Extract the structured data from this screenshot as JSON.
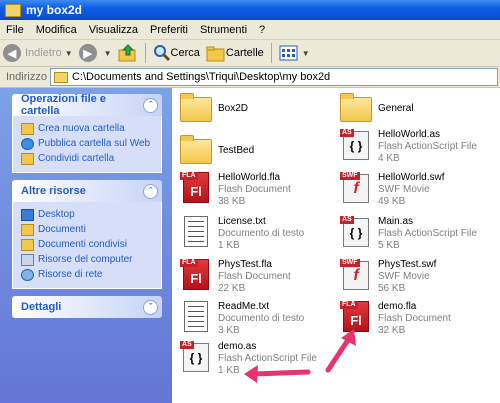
{
  "window": {
    "title": "my box2d"
  },
  "menu": [
    "File",
    "Modifica",
    "Visualizza",
    "Preferiti",
    "Strumenti",
    "?"
  ],
  "toolbar": {
    "back_label": "Indietro",
    "search_label": "Cerca",
    "folders_label": "Cartelle"
  },
  "address": {
    "label": "Indirizzo",
    "path": "C:\\Documents and Settings\\Triqui\\Desktop\\my box2d"
  },
  "left_panels": {
    "tasks": {
      "title": "Operazioni file e cartella",
      "items": [
        "Crea nuova cartella",
        "Pubblica cartella sul Web",
        "Condividi cartella"
      ]
    },
    "places": {
      "title": "Altre risorse",
      "items": [
        "Desktop",
        "Documenti",
        "Documenti condivisi",
        "Risorse del computer",
        "Risorse di rete"
      ]
    },
    "details": {
      "title": "Dettagli"
    }
  },
  "files": [
    {
      "name": "Box2D",
      "type": "",
      "size": "",
      "icon": "folder-icon"
    },
    {
      "name": "General",
      "type": "",
      "size": "",
      "icon": "folder-icon"
    },
    {
      "name": "TestBed",
      "type": "",
      "size": "",
      "icon": "folder-icon"
    },
    {
      "name": "HelloWorld.as",
      "type": "Flash ActionScript File",
      "size": "4 KB",
      "icon": "actionscript-file-icon"
    },
    {
      "name": "HelloWorld.fla",
      "type": "Flash Document",
      "size": "38 KB",
      "icon": "flash-document-icon"
    },
    {
      "name": "HelloWorld.swf",
      "type": "SWF Movie",
      "size": "49 KB",
      "icon": "swf-movie-icon"
    },
    {
      "name": "License.txt",
      "type": "Documento di testo",
      "size": "1 KB",
      "icon": "text-document-icon"
    },
    {
      "name": "Main.as",
      "type": "Flash ActionScript File",
      "size": "5 KB",
      "icon": "actionscript-file-icon"
    },
    {
      "name": "PhysTest.fla",
      "type": "Flash Document",
      "size": "22 KB",
      "icon": "flash-document-icon"
    },
    {
      "name": "PhysTest.swf",
      "type": "SWF Movie",
      "size": "56 KB",
      "icon": "swf-movie-icon"
    },
    {
      "name": "ReadMe.txt",
      "type": "Documento di testo",
      "size": "3 KB",
      "icon": "text-document-icon"
    },
    {
      "name": "demo.fla",
      "type": "Flash Document",
      "size": "32 KB",
      "icon": "flash-document-icon"
    },
    {
      "name": "demo.as",
      "type": "Flash ActionScript File",
      "size": "1 KB",
      "icon": "actionscript-file-icon"
    }
  ],
  "icon_badges": {
    "as": "AS",
    "fla": "FLA",
    "swf": "SWF",
    "fl": "Fl",
    "braces": "{ }",
    "f": "f"
  },
  "colors": {
    "titlebar": "#0a52d6",
    "left_pane": "#6f8fe0",
    "panel_head_text": "#215dc6",
    "annotation_arrow": "#e8336d"
  }
}
